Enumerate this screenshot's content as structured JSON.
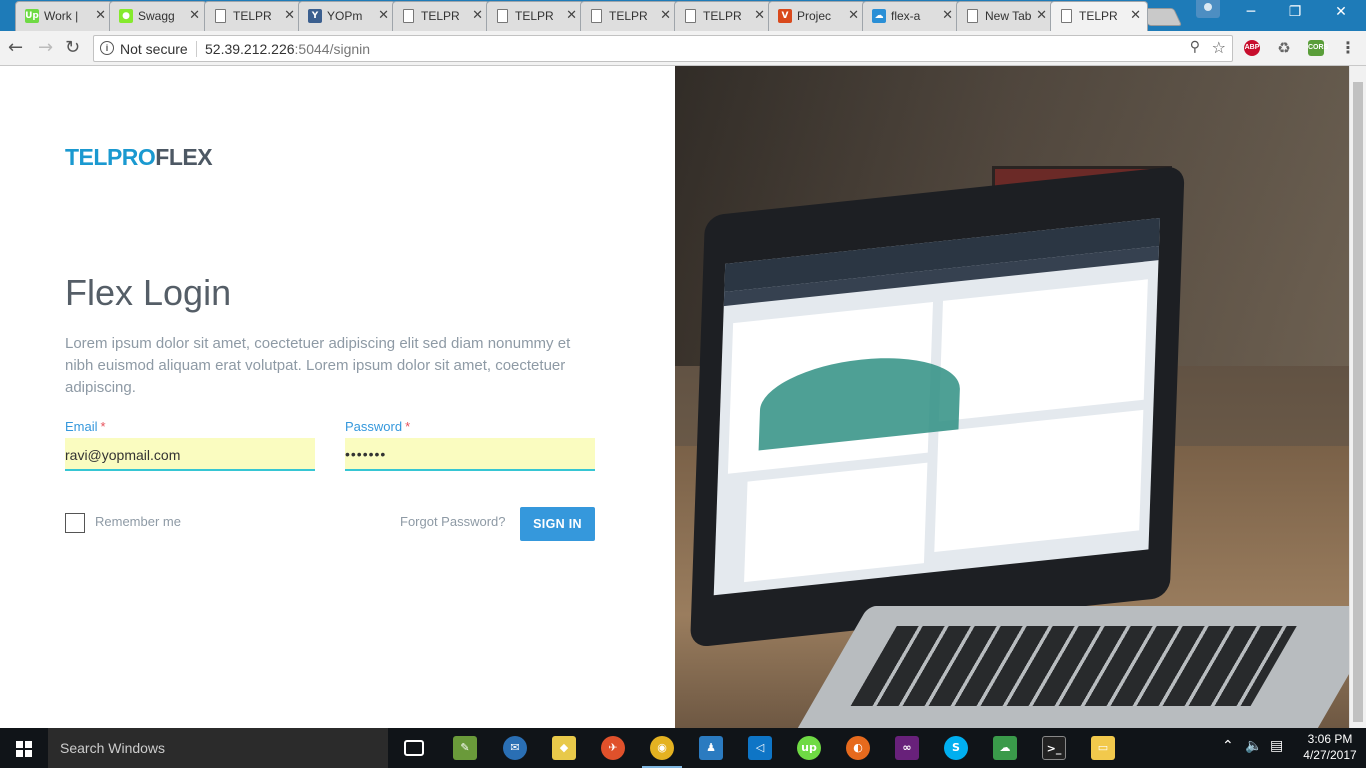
{
  "browser": {
    "tabs": [
      {
        "title": "Work |",
        "fav": "Up",
        "fav_color": "#6fda44"
      },
      {
        "title": "Swagg",
        "fav": "●",
        "fav_color": "#85ea2d"
      },
      {
        "title": "TELPR",
        "fav": "",
        "fav_color": ""
      },
      {
        "title": "YOPm",
        "fav": "Y",
        "fav_color": "#3b5f8f"
      },
      {
        "title": "TELPR",
        "fav": "",
        "fav_color": ""
      },
      {
        "title": "TELPR",
        "fav": "",
        "fav_color": ""
      },
      {
        "title": "TELPR",
        "fav": "",
        "fav_color": ""
      },
      {
        "title": "TELPR",
        "fav": "",
        "fav_color": ""
      },
      {
        "title": "Projec",
        "fav": "V",
        "fav_color": "#d9491c"
      },
      {
        "title": "flex-a",
        "fav": "☁",
        "fav_color": "#2a8fd6"
      },
      {
        "title": "New Tab",
        "fav": "",
        "fav_color": ""
      },
      {
        "title": "TELPR",
        "fav": "",
        "fav_color": ""
      }
    ],
    "security_label": "Not secure",
    "url_host": "52.39.212.226",
    "url_rest": ":5044/signin"
  },
  "login": {
    "logo_part1": "TELPRO",
    "logo_part2": "FLEX",
    "title": "Flex Login",
    "description": "Lorem ipsum dolor sit amet, coectetuer adipiscing elit sed diam nonummy et nibh euismod aliquam erat volutpat. Lorem ipsum dolor sit amet, coectetuer adipiscing.",
    "email_label": "Email",
    "email_value": "ravi@yopmail.com",
    "password_label": "Password",
    "password_mask": "•••••••",
    "required_mark": "*",
    "remember_label": "Remember me",
    "forgot_label": "Forgot Password?",
    "signin_label": "SIGN IN"
  },
  "taskbar": {
    "search_placeholder": "Search Windows",
    "time": "3:06 PM",
    "date": "4/27/2017"
  },
  "colors": {
    "brand_blue": "#1a99d0",
    "brand_gray": "#4d5864",
    "primary_button": "#3598dc",
    "autofill_bg": "#fafcc0",
    "tabstrip": "#1e7bb8"
  }
}
